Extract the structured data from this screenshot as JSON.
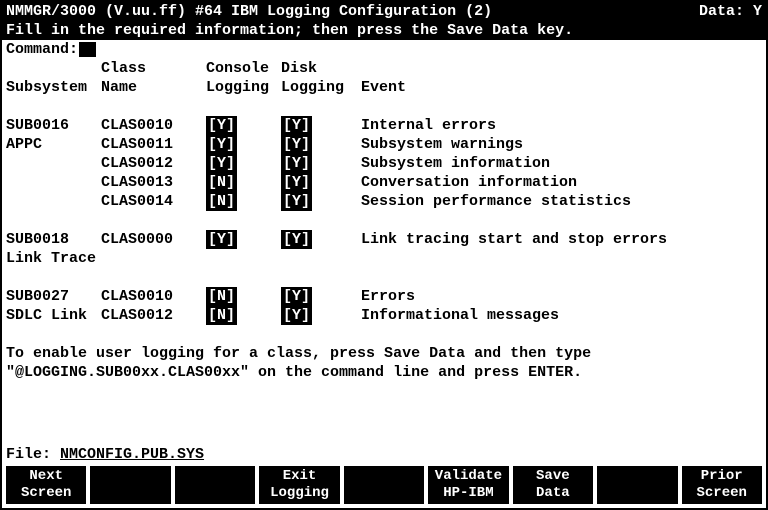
{
  "header": {
    "left": "NMMGR/3000 (V.uu.ff) #64  IBM Logging Configuration (2)",
    "right": "Data: Y",
    "instruction": "Fill in the required information; then press the Save Data key."
  },
  "command_label": "Command:",
  "columns": {
    "subsystem": "Subsystem",
    "class1": "Class",
    "class2": "Name",
    "console1": "Console",
    "console2": "Logging",
    "disk1": "Disk",
    "disk2": "Logging",
    "event": "Event"
  },
  "rows": [
    {
      "sub": "SUB0016",
      "class": "CLAS0010",
      "con": "[Y]",
      "disk": "[Y]",
      "event": "Internal errors"
    },
    {
      "sub": "APPC",
      "class": "CLAS0011",
      "con": "[Y]",
      "disk": "[Y]",
      "event": "Subsystem warnings"
    },
    {
      "sub": "",
      "class": "CLAS0012",
      "con": "[Y]",
      "disk": "[Y]",
      "event": "Subsystem information"
    },
    {
      "sub": "",
      "class": "CLAS0013",
      "con": "[N]",
      "disk": "[Y]",
      "event": "Conversation information"
    },
    {
      "sub": "",
      "class": "CLAS0014",
      "con": "[N]",
      "disk": "[Y]",
      "event": "Session performance statistics"
    }
  ],
  "group2_header": {
    "sub": "SUB0018",
    "class": "CLAS0000",
    "con": "[Y]",
    "disk": "[Y]",
    "event": "Link tracing start and stop errors"
  },
  "group2_label": "Link Trace",
  "group3": [
    {
      "sub": "SUB0027",
      "class": "CLAS0010",
      "con": "[N]",
      "disk": "[Y]",
      "event": "Errors"
    },
    {
      "sub": "SDLC Link",
      "class": "CLAS0012",
      "con": "[N]",
      "disk": "[Y]",
      "event": "Informational messages"
    }
  ],
  "help": {
    "line1": "To enable user logging for a class, press Save Data and then type",
    "line2": "\"@LOGGING.SUB00xx.CLAS00xx\" on the command line and press ENTER."
  },
  "file_label": "File:  ",
  "file_value": "NMCONFIG.PUB.SYS",
  "fkeys": [
    {
      "l1": "Next",
      "l2": "Screen"
    },
    {
      "l1": "",
      "l2": ""
    },
    {
      "l1": "",
      "l2": ""
    },
    {
      "l1": "Exit",
      "l2": "Logging"
    },
    {
      "l1": "",
      "l2": ""
    },
    {
      "l1": "Validate",
      "l2": "HP-IBM"
    },
    {
      "l1": "Save",
      "l2": "Data"
    },
    {
      "l1": "",
      "l2": ""
    },
    {
      "l1": "Prior",
      "l2": "Screen"
    }
  ]
}
